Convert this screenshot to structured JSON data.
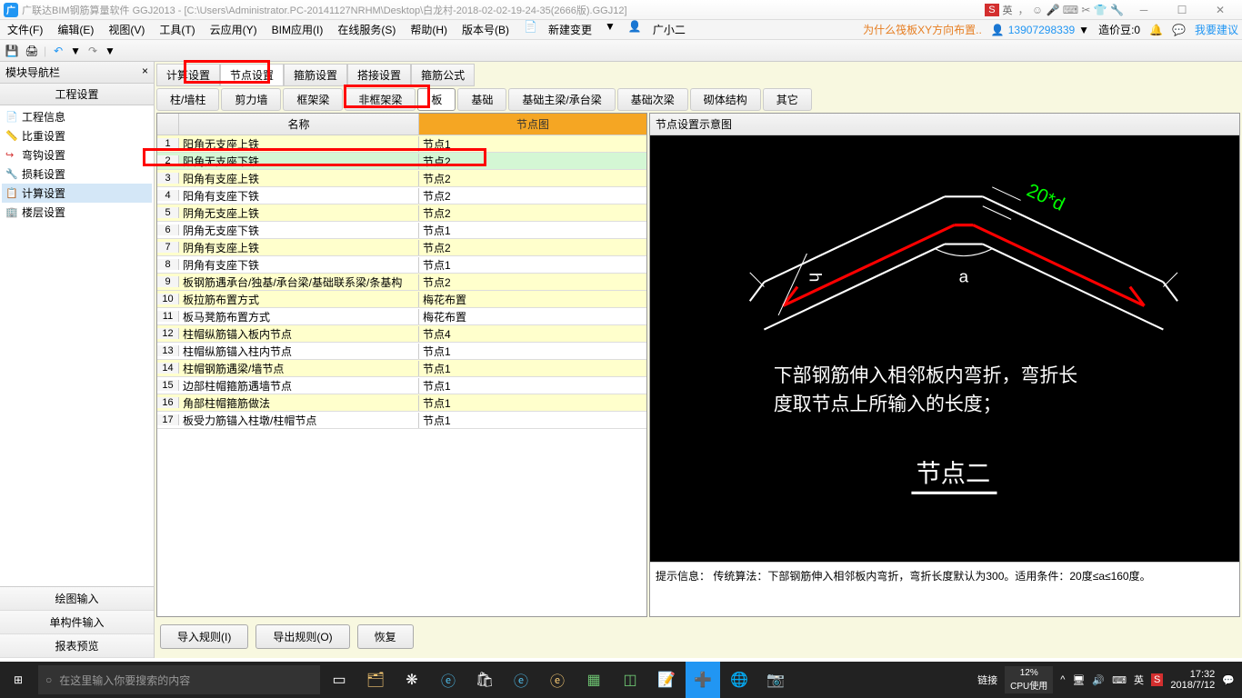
{
  "titlebar": {
    "app_icon": "广",
    "title": "广联达BIM钢筋算量软件 GGJ2013 - [C:\\Users\\Administrator.PC-20141127NRHM\\Desktop\\白龙村-2018-02-02-19-24-35(2666版).GGJ12]",
    "ime_box": "S",
    "ime_text": "英",
    "ime_icons": "， ☺ 🎤 ⌨ ✂ 👕 🔧"
  },
  "menubar": {
    "items": [
      "文件(F)",
      "编辑(E)",
      "视图(V)",
      "工具(T)",
      "云应用(Y)",
      "BIM应用(I)",
      "在线服务(S)",
      "帮助(H)",
      "版本号(B)"
    ],
    "new_change": "新建变更",
    "user_small": "广小二",
    "notice": "为什么筏板XY方向布置..",
    "phone": "13907298339",
    "cost": "造价豆:0",
    "suggest": "我要建议"
  },
  "sidebar": {
    "title": "模块导航栏",
    "subtitle": "工程设置",
    "items": [
      {
        "icon": "📄",
        "label": "工程信息"
      },
      {
        "icon": "📏",
        "label": "比重设置"
      },
      {
        "icon": "↪",
        "label": "弯钩设置"
      },
      {
        "icon": "🔧",
        "label": "损耗设置"
      },
      {
        "icon": "📋",
        "label": "计算设置"
      },
      {
        "icon": "🏢",
        "label": "楼层设置"
      }
    ],
    "buttons": [
      "绘图输入",
      "单构件输入",
      "报表预览"
    ]
  },
  "tabs1": [
    "计算设置",
    "节点设置",
    "箍筋设置",
    "搭接设置",
    "箍筋公式"
  ],
  "tabs2": [
    "柱/墙柱",
    "剪力墙",
    "框架梁",
    "非框架梁",
    "板",
    "基础",
    "基础主梁/承台梁",
    "基础次梁",
    "砌体结构",
    "其它"
  ],
  "table": {
    "headers": {
      "name": "名称",
      "node": "节点图"
    },
    "rows": [
      {
        "n": "1",
        "name": "阳角无支座上铁",
        "node": "节点1",
        "hl": true
      },
      {
        "n": "2",
        "name": "阳角无支座下铁",
        "node": "节点2",
        "active": true
      },
      {
        "n": "3",
        "name": "阳角有支座上铁",
        "node": "节点2",
        "hl": true
      },
      {
        "n": "4",
        "name": "阳角有支座下铁",
        "node": "节点2"
      },
      {
        "n": "5",
        "name": "阴角无支座上铁",
        "node": "节点2",
        "hl": true
      },
      {
        "n": "6",
        "name": "阴角无支座下铁",
        "node": "节点1"
      },
      {
        "n": "7",
        "name": "阴角有支座上铁",
        "node": "节点2",
        "hl": true
      },
      {
        "n": "8",
        "name": "阴角有支座下铁",
        "node": "节点1"
      },
      {
        "n": "9",
        "name": "板钢筋遇承台/独基/承台梁/基础联系梁/条基构",
        "node": "节点2",
        "hl": true
      },
      {
        "n": "10",
        "name": "板拉筋布置方式",
        "node": "梅花布置",
        "hl": true
      },
      {
        "n": "11",
        "name": "板马凳筋布置方式",
        "node": "梅花布置"
      },
      {
        "n": "12",
        "name": "柱帽纵筋锚入板内节点",
        "node": "节点4",
        "hl": true
      },
      {
        "n": "13",
        "name": "柱帽纵筋锚入柱内节点",
        "node": "节点1"
      },
      {
        "n": "14",
        "name": "柱帽钢筋遇梁/墙节点",
        "node": "节点1",
        "hl": true
      },
      {
        "n": "15",
        "name": "边部柱帽箍筋遇墙节点",
        "node": "节点1"
      },
      {
        "n": "16",
        "name": "角部柱帽箍筋做法",
        "node": "节点1",
        "hl": true
      },
      {
        "n": "17",
        "name": "板受力筋锚入柱墩/柱帽节点",
        "node": "节点1"
      }
    ]
  },
  "diagram": {
    "title": "节点设置示意图",
    "label_20d": "20*d",
    "label_h": "h",
    "label_a": "a",
    "desc1": "下部钢筋伸入相邻板内弯折，弯折长",
    "desc2": "度取节点上所输入的长度；",
    "node_label": "节点二",
    "hint_label": "提示信息：",
    "hint_text": "传统算法：下部钢筋伸入相邻板内弯折，弯折长度默认为300。适用条件：20度≤a≤160度。"
  },
  "buttons": {
    "import": "导入规则(I)",
    "export": "导出规则(O)",
    "restore": "恢复"
  },
  "taskbar": {
    "search_placeholder": "在这里输入你要搜索的内容",
    "link_text": "链接",
    "cpu_pct": "12%",
    "cpu_label": "CPU使用",
    "time": "17:32",
    "date": "2018/7/12"
  }
}
